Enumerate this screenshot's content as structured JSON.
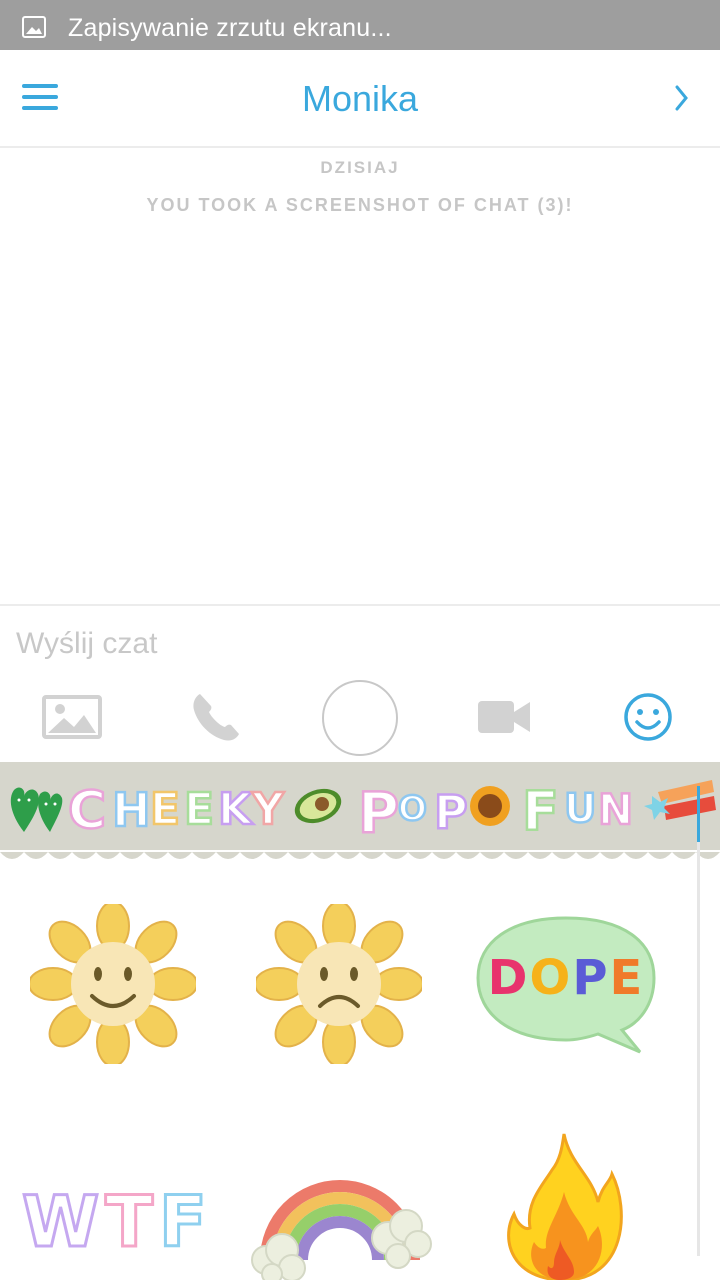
{
  "status_bar": {
    "notification": "Zapisywanie zrzutu ekranu..."
  },
  "header": {
    "title": "Monika"
  },
  "chat": {
    "date_label": "DZISIAJ",
    "notice": "YOU TOOK A SCREENSHOT OF CHAT (3)!"
  },
  "input": {
    "placeholder": "Wyślij czat"
  },
  "toolbar": {
    "icons": [
      "image-icon",
      "phone-icon",
      "camera-capture-button",
      "video-camera-icon",
      "smiley-icon"
    ]
  },
  "sticker_pack": {
    "banner": [
      "CHEEKY",
      "POP",
      "FUN"
    ],
    "stickers": [
      "happy-sunflower",
      "sad-sunflower",
      "DOPE",
      "WTF",
      "rainbow",
      "fire"
    ],
    "sticker_texts": {
      "dope": "DOPE",
      "wtf": "WTF"
    }
  },
  "colors": {
    "accent": "#3aa8dd",
    "status_bar": "#9e9e9e",
    "sticker_bar": "#d6d6cc",
    "muted": "#c6c6c6"
  }
}
